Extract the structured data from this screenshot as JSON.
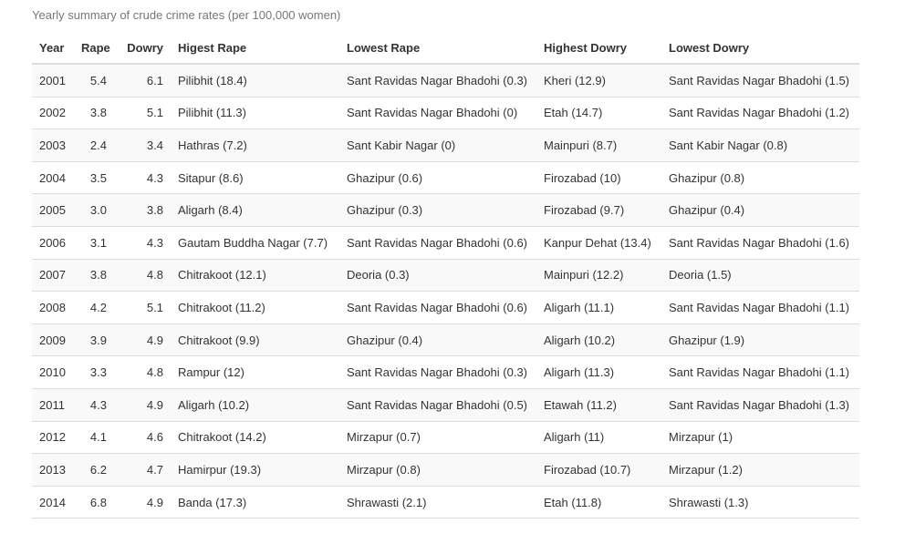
{
  "caption": "Yearly summary of crude crime rates (per 100,000 women)",
  "columns": [
    "Year",
    "Rape",
    "Dowry",
    "Higest Rape",
    "Lowest Rape",
    "Highest Dowry",
    "Lowest Dowry"
  ],
  "rows": [
    [
      "2001",
      "5.4",
      "6.1",
      "Pilibhit (18.4)",
      "Sant Ravidas Nagar Bhadohi (0.3)",
      "Kheri (12.9)",
      "Sant Ravidas Nagar Bhadohi (1.5)"
    ],
    [
      "2002",
      "3.8",
      "5.1",
      "Pilibhit (11.3)",
      "Sant Ravidas Nagar Bhadohi (0)",
      "Etah (14.7)",
      "Sant Ravidas Nagar Bhadohi (1.2)"
    ],
    [
      "2003",
      "2.4",
      "3.4",
      "Hathras (7.2)",
      "Sant Kabir Nagar (0)",
      "Mainpuri (8.7)",
      "Sant Kabir Nagar (0.8)"
    ],
    [
      "2004",
      "3.5",
      "4.3",
      "Sitapur (8.6)",
      "Ghazipur (0.6)",
      "Firozabad (10)",
      "Ghazipur (0.8)"
    ],
    [
      "2005",
      "3.0",
      "3.8",
      "Aligarh (8.4)",
      "Ghazipur (0.3)",
      "Firozabad (9.7)",
      "Ghazipur (0.4)"
    ],
    [
      "2006",
      "3.1",
      "4.3",
      "Gautam Buddha Nagar (7.7)",
      "Sant Ravidas Nagar Bhadohi (0.6)",
      "Kanpur Dehat (13.4)",
      "Sant Ravidas Nagar Bhadohi (1.6)"
    ],
    [
      "2007",
      "3.8",
      "4.8",
      "Chitrakoot (12.1)",
      "Deoria (0.3)",
      "Mainpuri (12.2)",
      "Deoria (1.5)"
    ],
    [
      "2008",
      "4.2",
      "5.1",
      "Chitrakoot (11.2)",
      "Sant Ravidas Nagar Bhadohi (0.6)",
      "Aligarh (11.1)",
      "Sant Ravidas Nagar Bhadohi (1.1)"
    ],
    [
      "2009",
      "3.9",
      "4.9",
      "Chitrakoot (9.9)",
      "Ghazipur (0.4)",
      "Aligarh (10.2)",
      "Ghazipur (1.9)"
    ],
    [
      "2010",
      "3.3",
      "4.8",
      "Rampur (12)",
      "Sant Ravidas Nagar Bhadohi (0.3)",
      "Aligarh (11.3)",
      "Sant Ravidas Nagar Bhadohi (1.1)"
    ],
    [
      "2011",
      "4.3",
      "4.9",
      "Aligarh (10.2)",
      "Sant Ravidas Nagar Bhadohi (0.5)",
      "Etawah (11.2)",
      "Sant Ravidas Nagar Bhadohi (1.3)"
    ],
    [
      "2012",
      "4.1",
      "4.6",
      "Chitrakoot (14.2)",
      "Mirzapur (0.7)",
      "Aligarh (11)",
      "Mirzapur (1)"
    ],
    [
      "2013",
      "6.2",
      "4.7",
      "Hamirpur (19.3)",
      "Mirzapur (0.8)",
      "Firozabad (10.7)",
      "Mirzapur (1.2)"
    ],
    [
      "2014",
      "6.8",
      "4.9",
      "Banda (17.3)",
      "Shrawasti (2.1)",
      "Etah (11.8)",
      "Shrawasti (1.3)"
    ]
  ]
}
